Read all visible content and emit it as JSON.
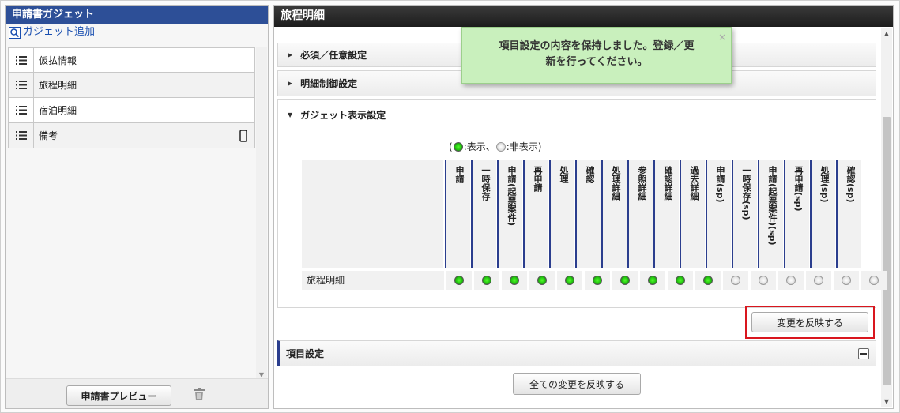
{
  "left": {
    "title": "申請書ガジェット",
    "add_label": "ガジェット追加",
    "items": [
      {
        "label": "仮払情報",
        "device": false
      },
      {
        "label": "旅程明細",
        "device": false
      },
      {
        "label": "宿泊明細",
        "device": false
      },
      {
        "label": "備考",
        "device": true
      }
    ],
    "preview_label": "申請書プレビュー"
  },
  "right": {
    "title": "旅程明細",
    "sections": {
      "required": "必須／任意設定",
      "detail_control": "明細制御設定",
      "gadget_display": "ガジェット表示設定",
      "item_settings": "項目設定"
    },
    "legend": {
      "show": ":表示、",
      "hide": ":非表示)",
      "open": "("
    },
    "columns": [
      "申請",
      "一時保存",
      "申請(起票案件)",
      "再申請",
      "処理",
      "確認",
      "処理詳細",
      "参照詳細",
      "確認詳細",
      "過去詳細",
      "申請(sp)",
      "一時保存(sp)",
      "申請(起票案件)(sp)",
      "再申請(sp)",
      "処理(sp)",
      "確認(sp)"
    ],
    "row": {
      "label": "旅程明細",
      "values": [
        true,
        true,
        true,
        true,
        true,
        true,
        true,
        true,
        true,
        true,
        false,
        false,
        false,
        false,
        false,
        false
      ]
    },
    "apply_label": "変更を反映する",
    "apply_all_label": "全ての変更を反映する"
  },
  "toast": {
    "message_line1": "項目設定の内容を保持しました。登録／更",
    "message_line2": "新を行ってください。",
    "close": "×"
  },
  "colors": {
    "left_header": "#2d4f97",
    "right_header": "#1d1d1d",
    "toast_bg": "#c9f0bd",
    "highlight": "#d9161e",
    "column_accent": "#2b3e8e"
  }
}
